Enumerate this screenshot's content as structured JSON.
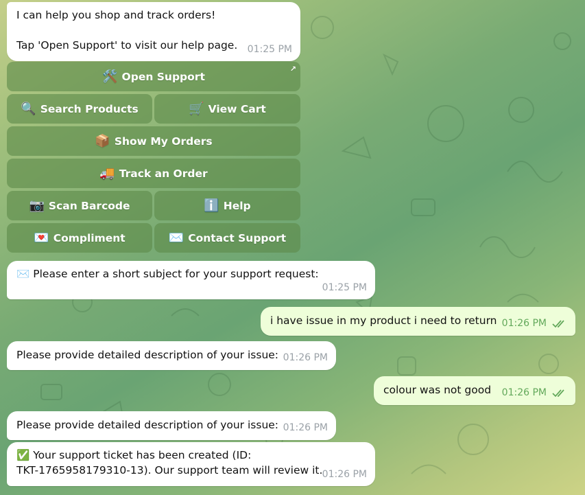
{
  "messages": {
    "m1": {
      "line1": "I can help you shop and track orders!",
      "line2": "Tap 'Open Support' to visit our help page.",
      "time": "01:25 PM"
    },
    "m2": {
      "icon": "✉️",
      "text": "Please enter a short subject for your support request:",
      "time": "01:25 PM"
    },
    "m3": {
      "text": "i have issue in my product i need to return",
      "time": "01:26 PM"
    },
    "m4": {
      "text": "Please provide detailed description of your issue:",
      "time": "01:26 PM"
    },
    "m5": {
      "text": "colour was not good",
      "time": "01:26 PM"
    },
    "m6": {
      "text": "Please provide detailed description of your issue:",
      "time": "01:26 PM"
    },
    "m7": {
      "icon": "✅",
      "line1": "Your support ticket has been created (ID:",
      "line2": "TKT-1765958179310-13). Our support team will review it.",
      "time": "01:26 PM"
    }
  },
  "keyboard": {
    "open_support": {
      "emoji": "🛠️",
      "label": "Open Support",
      "link_icon": "↗"
    },
    "search_products": {
      "emoji": "🔍",
      "label": "Search Products"
    },
    "view_cart": {
      "emoji": "🛒",
      "label": "View Cart"
    },
    "show_orders": {
      "emoji": "📦",
      "label": "Show My Orders"
    },
    "track_order": {
      "emoji": "🚚",
      "label": "Track an Order"
    },
    "scan_barcode": {
      "emoji": "📷",
      "label": "Scan Barcode"
    },
    "help": {
      "emoji": "ℹ️",
      "label": "Help"
    },
    "compliment": {
      "emoji": "💌",
      "label": "Compliment"
    },
    "contact_support": {
      "emoji": "✉️",
      "label": "Contact Support"
    }
  },
  "colors": {
    "read_ticks": "#62a85a",
    "keyboard_button": "#5d8a4b",
    "outgoing_bubble": "#eefed9"
  }
}
